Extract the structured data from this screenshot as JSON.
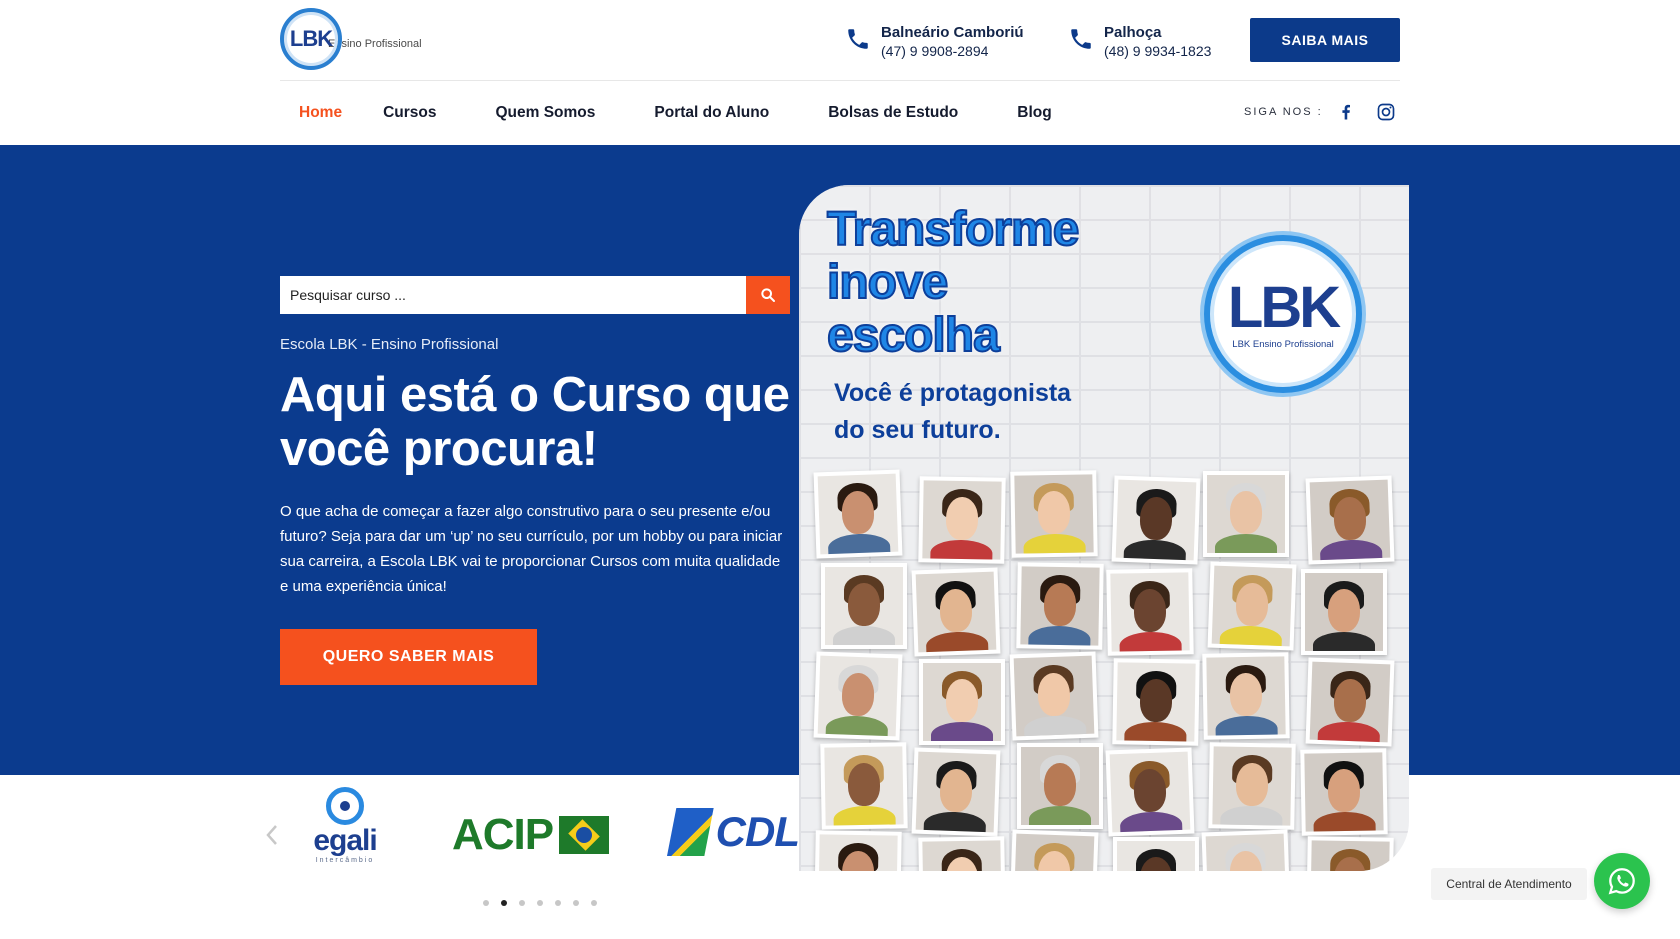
{
  "brand": {
    "logo_text": "LBK",
    "logo_subtitle": "Ensino Profissional"
  },
  "contacts": [
    {
      "city": "Balneário Camboriú",
      "phone": "(47) 9 9908-2894",
      "icon": "phone-icon"
    },
    {
      "city": "Palhoça",
      "phone": "(48) 9 9934-1823",
      "icon": "phone-icon"
    }
  ],
  "header": {
    "cta_label": "SAIBA MAIS"
  },
  "nav": {
    "items": [
      {
        "label": "Home",
        "active": true
      },
      {
        "label": "Cursos"
      },
      {
        "label": "Quem Somos"
      },
      {
        "label": "Portal do Aluno"
      },
      {
        "label": "Bolsas de Estudo"
      },
      {
        "label": "Blog"
      }
    ],
    "social_label": "SIGA NOS :",
    "social": [
      "facebook-icon",
      "instagram-icon"
    ]
  },
  "hero": {
    "search_placeholder": "Pesquisar curso ...",
    "eyebrow": "Escola LBK - Ensino Profissional",
    "headline": "Aqui está o Curso que você procura!",
    "body": "O que acha de começar a fazer algo construtivo para o seu presente e/ou futuro? Seja para dar um ‘up’ no seu currículo, por um hobby ou para iniciar sua carreira, a  Escola LBK vai te proporcionar Cursos com muita qualidade e uma experiência única!",
    "cta_label": "QUERO SABER MAIS"
  },
  "promo": {
    "title_lines": [
      "Transforme",
      "inove",
      "escolha"
    ],
    "subtitle_lines": [
      "Você é protagonista",
      "do seu futuro."
    ],
    "logo_text": "LBK",
    "logo_subtitle": "LBK Ensino Profissional"
  },
  "partners": {
    "egali": {
      "name": "egali",
      "tagline": "Intercâmbio"
    },
    "acip": {
      "name": "ACIP"
    },
    "cdl": {
      "name": "CDL"
    },
    "active_dot": 1,
    "dot_count": 7
  },
  "chat": {
    "label": "Central de Atendimento",
    "icon": "whatsapp-icon"
  },
  "colors": {
    "navy": "#0b3b8e",
    "accent": "#f5511e",
    "whatsapp": "#2bc34e"
  }
}
